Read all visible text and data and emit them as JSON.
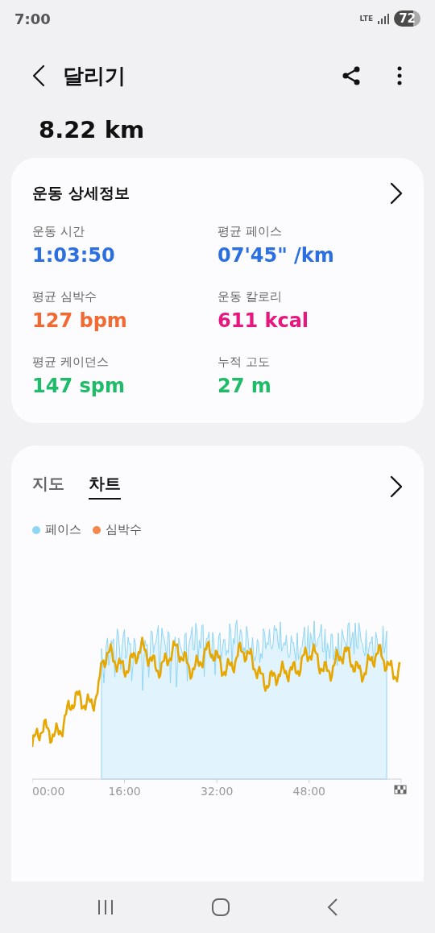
{
  "status_bar": {
    "time": "7:00",
    "network": "LTE",
    "battery": "72"
  },
  "header": {
    "title": "달리기"
  },
  "distance": "8.22 km",
  "details": {
    "title": "운동 상세정보",
    "metrics": [
      {
        "label": "운동 시간",
        "value": "1:03:50",
        "color": "#2b6fe0"
      },
      {
        "label": "평균 페이스",
        "value": "07'45\" /km",
        "color": "#2b6fe0"
      },
      {
        "label": "평균 심박수",
        "value": "127 bpm",
        "color": "#f26a33"
      },
      {
        "label": "운동 칼로리",
        "value": "611 kcal",
        "color": "#e8177d"
      },
      {
        "label": "평균 케이던스",
        "value": "147 spm",
        "color": "#1ebc68"
      },
      {
        "label": "누적 고도",
        "value": "27 m",
        "color": "#1ebc68"
      }
    ]
  },
  "chart_panel": {
    "tabs": [
      {
        "label": "지도",
        "selected": false
      },
      {
        "label": "차트",
        "selected": true
      }
    ],
    "legend": [
      {
        "label": "페이스",
        "color": "#8fd6f5"
      },
      {
        "label": "심박수",
        "color": "#f5864c"
      }
    ],
    "x_axis_labels": [
      "00:00",
      "16:00",
      "32:00",
      "48:00"
    ]
  }
}
